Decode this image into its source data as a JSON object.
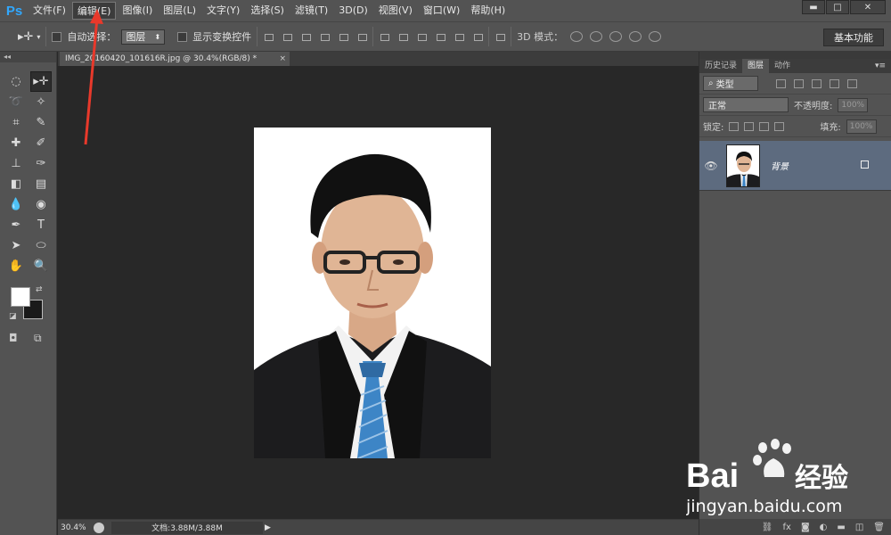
{
  "app": {
    "logo": "Ps"
  },
  "menu": [
    "文件(F)",
    "编辑(E)",
    "图像(I)",
    "图层(L)",
    "文字(Y)",
    "选择(S)",
    "滤镜(T)",
    "3D(D)",
    "视图(V)",
    "窗口(W)",
    "帮助(H)"
  ],
  "menu_active_index": 1,
  "window_controls": [
    "minimize-icon",
    "maximize-icon",
    "close-icon"
  ],
  "options_bar": {
    "auto_select_label": "自动选择：",
    "auto_select_target": "图层",
    "show_transform_label": "显示变换控件",
    "mode_3d_label": "3D 模式：",
    "workspace": "基本功能"
  },
  "document": {
    "tab_title": "IMG_20160420_101616R.jpg @ 30.4%(RGB/8) *",
    "tab_close": "×"
  },
  "status": {
    "zoom": "30.4%",
    "doc_size": "文档:3.88M/3.88M"
  },
  "panels": {
    "tabs": [
      "历史记录",
      "图层",
      "动作"
    ],
    "active_tab_index": 1,
    "filter_kind": "类型",
    "blend_mode": "正常",
    "opacity_label": "不透明度:",
    "opacity_value": "100%",
    "lock_label": "锁定:",
    "fill_label": "填充:",
    "fill_value": "100%",
    "layers": [
      {
        "name": "背景",
        "visible": true,
        "locked": true
      }
    ]
  },
  "colors": {
    "accent": "#31a8ff",
    "annotation": "#e8392b",
    "foreground": "#ffffff",
    "background": "#1a1a1a",
    "selected_layer": "#5d6b7f"
  },
  "watermark": {
    "brand": "Bai",
    "brand_suffix": "经验",
    "url": "jingyan.baidu.com"
  }
}
